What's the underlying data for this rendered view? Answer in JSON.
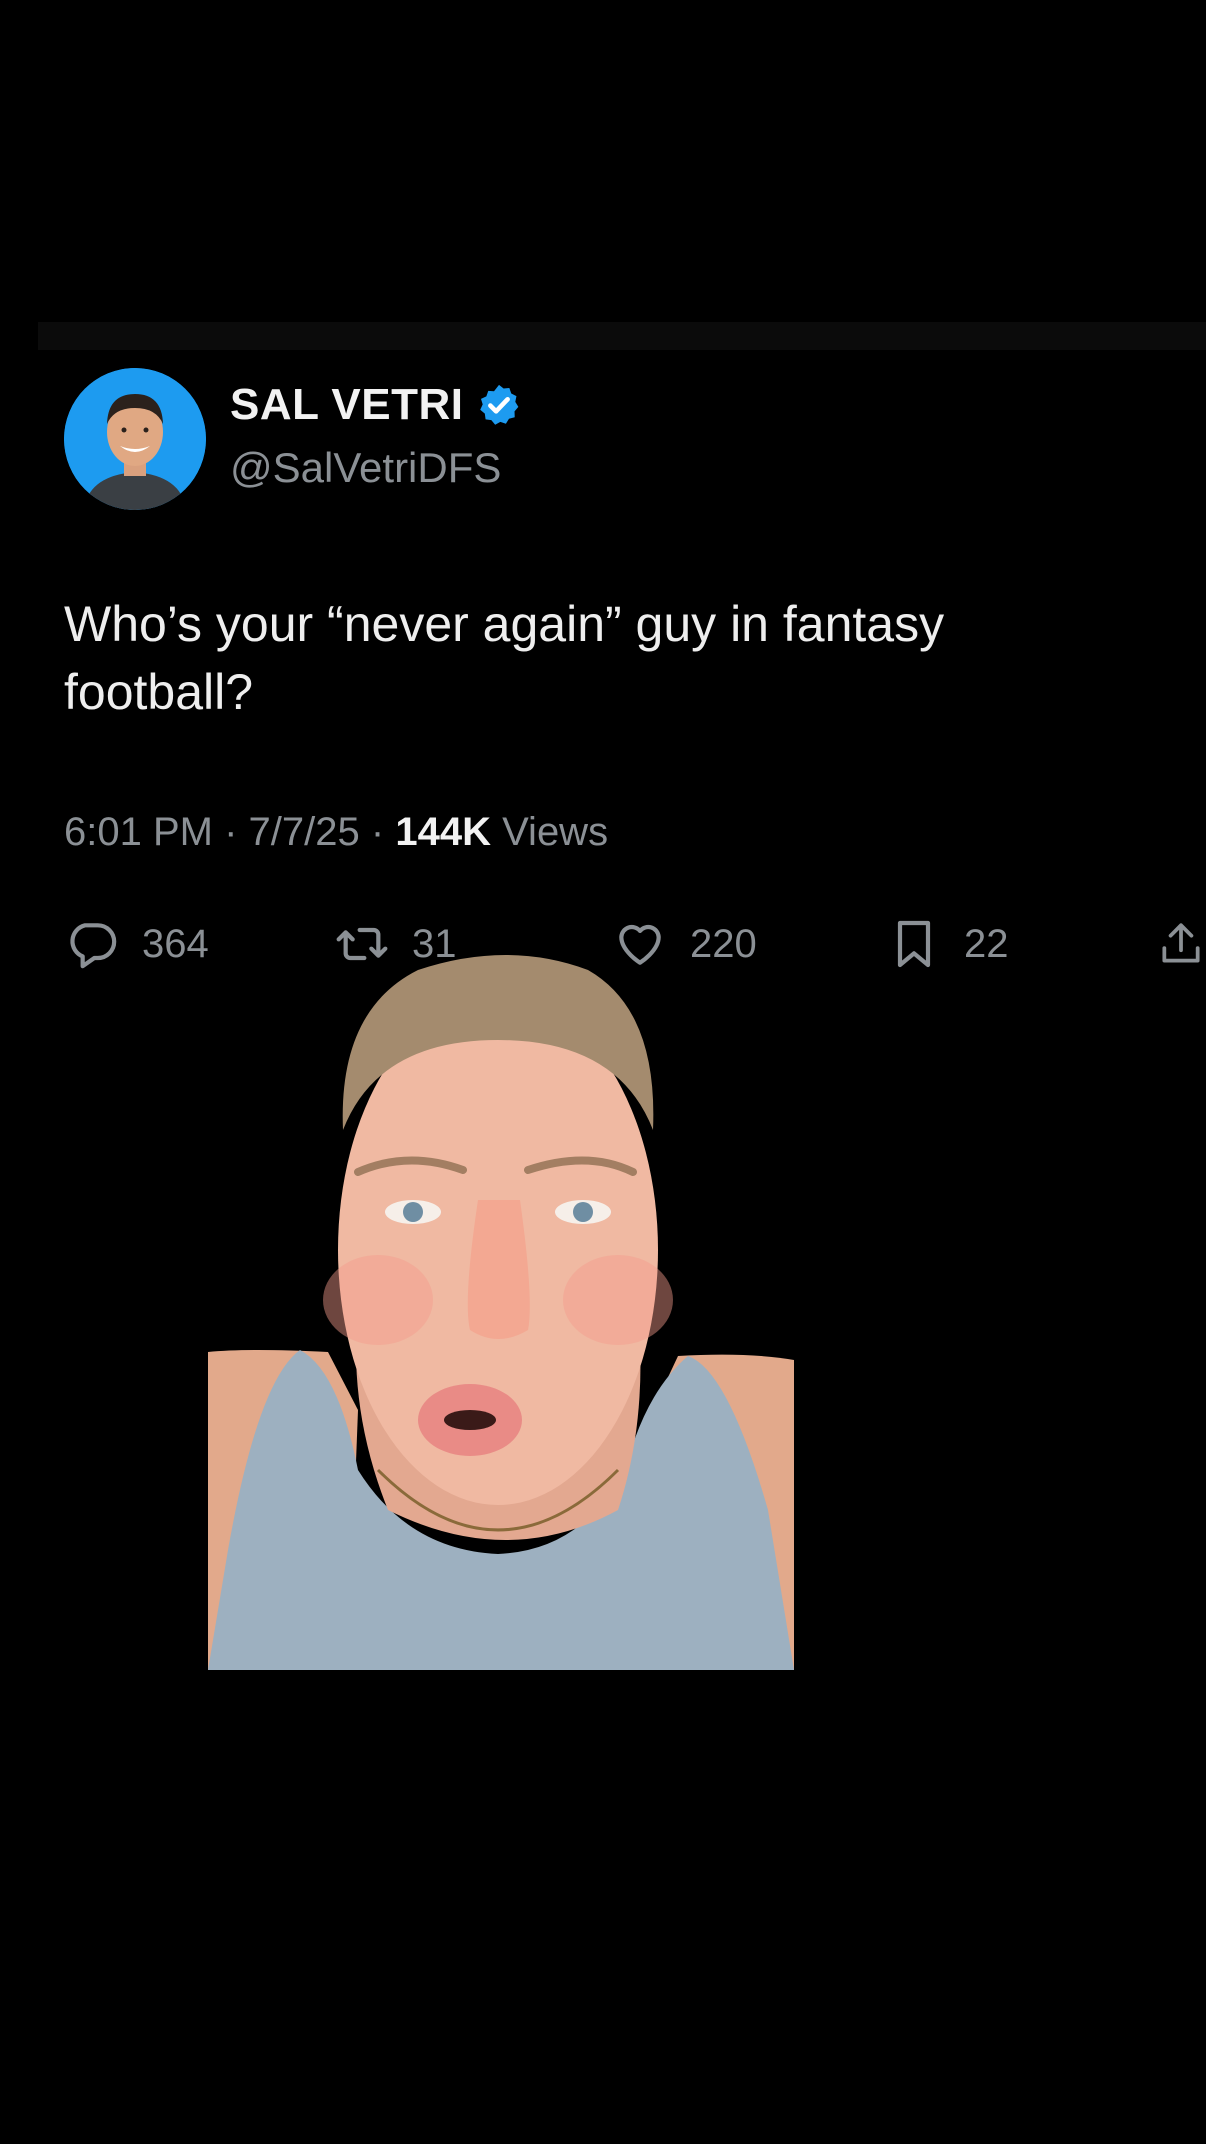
{
  "tweet": {
    "display_name": "SAL VETRI",
    "handle": "@SalVetriDFS",
    "text": "Who’s your “never again” guy in fantasy football?",
    "time": "6:01 PM",
    "date": "7/7/25",
    "separator": "·",
    "views_count": "144K",
    "views_label": "Views"
  },
  "actions": {
    "replies": "364",
    "reposts": "31",
    "likes": "220",
    "bookmarks": "22"
  },
  "colors": {
    "background": "#000000",
    "verified_badge": "#1d9bf0",
    "avatar_bg": "#1d9bf0",
    "secondary_text": "#8b9095"
  },
  "icons": [
    "verified-badge-icon",
    "reply-icon",
    "repost-icon",
    "like-icon",
    "bookmark-icon",
    "share-icon"
  ]
}
